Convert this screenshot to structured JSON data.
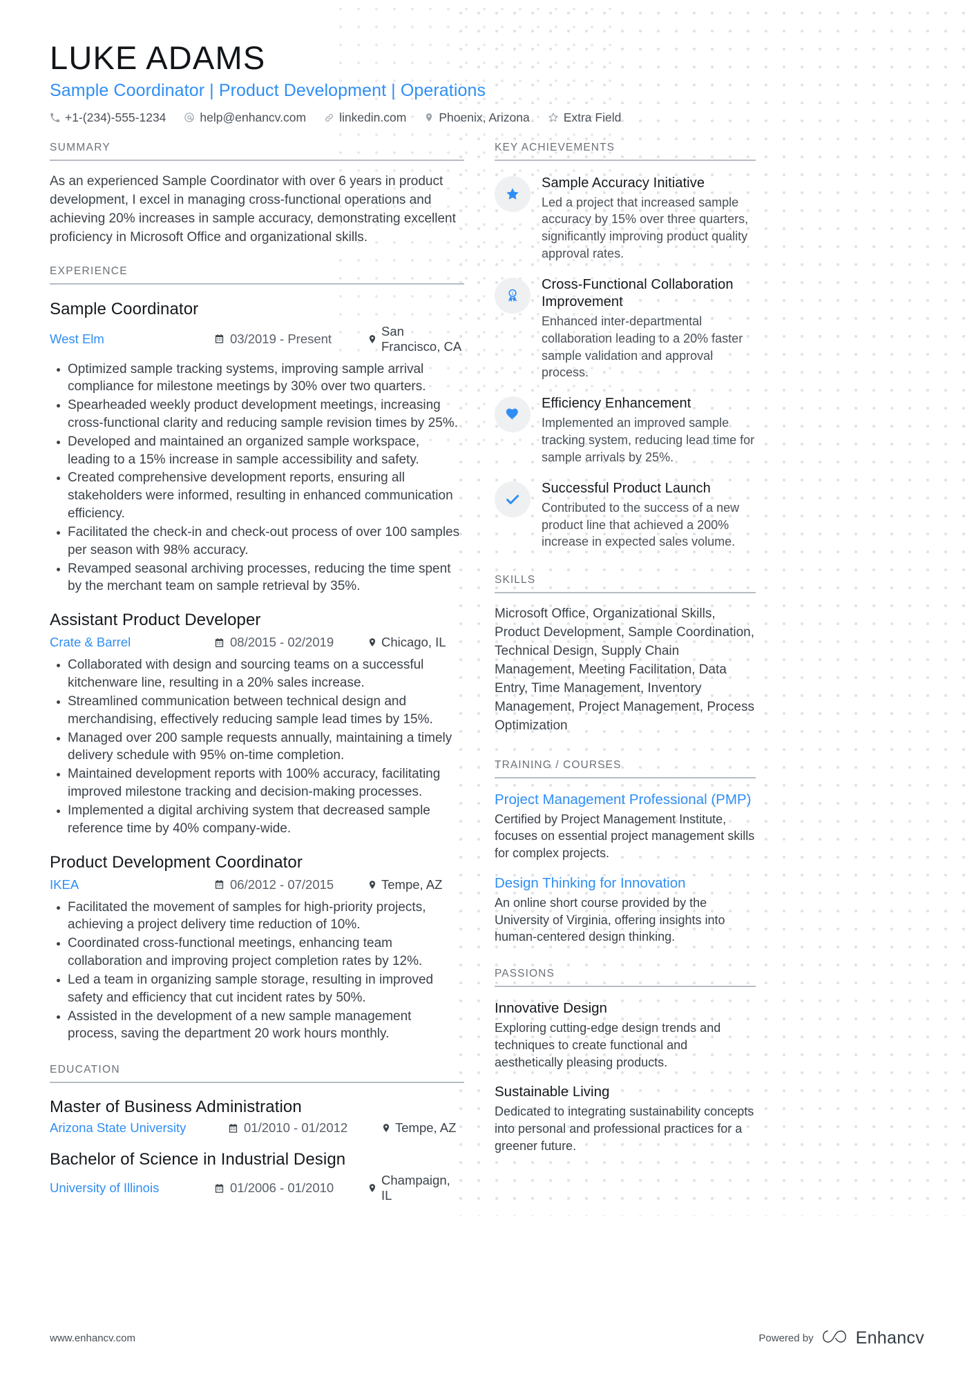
{
  "colors": {
    "accent": "#2f8ef4",
    "heading": "#6b7178",
    "text": "#3b4249",
    "badge_bg": "#eff0f1"
  },
  "header": {
    "name": "LUKE ADAMS",
    "headline": "Sample Coordinator | Product Development | Operations",
    "contacts": [
      {
        "icon": "phone-icon",
        "text": "+1-(234)-555-1234"
      },
      {
        "icon": "email-icon",
        "text": "help@enhancv.com"
      },
      {
        "icon": "link-icon",
        "text": "linkedin.com"
      },
      {
        "icon": "location-icon",
        "text": "Phoenix, Arizona"
      },
      {
        "icon": "star-outline-icon",
        "text": "Extra Field"
      }
    ]
  },
  "summary": {
    "title": "SUMMARY",
    "text": "As an experienced Sample Coordinator with over 6 years in product development, I excel in managing cross-functional operations and achieving 20% increases in sample accuracy, demonstrating excellent proficiency in Microsoft Office and organizational skills."
  },
  "experience": {
    "title": "EXPERIENCE",
    "entries": [
      {
        "role": "Sample Coordinator",
        "company": "West Elm",
        "dates": "03/2019 - Present",
        "location": "San Francisco, CA",
        "bullets": [
          "Optimized sample tracking systems, improving sample arrival compliance for milestone meetings by 30% over two quarters.",
          "Spearheaded weekly product development meetings, increasing cross-functional clarity and reducing sample revision times by 25%.",
          "Developed and maintained an organized sample workspace, leading to a 15% increase in sample accessibility and safety.",
          "Created comprehensive development reports, ensuring all stakeholders were informed, resulting in enhanced communication efficiency.",
          "Facilitated the check-in and check-out process of over 100 samples per season with 98% accuracy.",
          "Revamped seasonal archiving processes, reducing the time spent by the merchant team on sample retrieval by 35%."
        ]
      },
      {
        "role": "Assistant Product Developer",
        "company": "Crate & Barrel",
        "dates": "08/2015 - 02/2019",
        "location": "Chicago, IL",
        "bullets": [
          "Collaborated with design and sourcing teams on a successful kitchenware line, resulting in a 20% sales increase.",
          "Streamlined communication between technical design and merchandising, effectively reducing sample lead times by 15%.",
          "Managed over 200 sample requests annually, maintaining a timely delivery schedule with 95% on-time completion.",
          "Maintained development reports with 100% accuracy, facilitating improved milestone tracking and decision-making processes.",
          "Implemented a digital archiving system that decreased sample reference time by 40% company-wide."
        ]
      },
      {
        "role": "Product Development Coordinator",
        "company": "IKEA",
        "dates": "06/2012 - 07/2015",
        "location": "Tempe, AZ",
        "bullets": [
          "Facilitated the movement of samples for high-priority projects, achieving a project delivery time reduction of 10%.",
          "Coordinated cross-functional meetings, enhancing team collaboration and improving project completion rates by 12%.",
          "Led a team in organizing sample storage, resulting in improved safety and efficiency that cut incident rates by 50%.",
          "Assisted in the development of a new sample management process, saving the department 20 work hours monthly."
        ]
      }
    ]
  },
  "education": {
    "title": "EDUCATION",
    "entries": [
      {
        "degree": "Master of Business Administration",
        "school": "Arizona State University",
        "dates": "01/2010 - 01/2012",
        "location": "Tempe, AZ"
      },
      {
        "degree": "Bachelor of Science in Industrial Design",
        "school": "University of Illinois",
        "dates": "01/2006 - 01/2010",
        "location": "Champaign, IL"
      }
    ]
  },
  "key_achievements": {
    "title": "KEY ACHIEVEMENTS",
    "items": [
      {
        "icon": "star-icon",
        "title": "Sample Accuracy Initiative",
        "desc": "Led a project that increased sample accuracy by 15% over three quarters, significantly improving product quality approval rates."
      },
      {
        "icon": "award-ribbon-icon",
        "title": "Cross-Functional Collaboration Improvement",
        "desc": "Enhanced inter-departmental collaboration leading to a 20% faster sample validation and approval process."
      },
      {
        "icon": "heart-icon",
        "title": "Efficiency Enhancement",
        "desc": "Implemented an improved sample tracking system, reducing lead time for sample arrivals by 25%."
      },
      {
        "icon": "check-icon",
        "title": "Successful Product Launch",
        "desc": "Contributed to the success of a new product line that achieved a 200% increase in expected sales volume."
      }
    ]
  },
  "skills": {
    "title": "SKILLS",
    "text": "Microsoft Office, Organizational Skills, Product Development, Sample Coordination, Technical Design, Supply Chain Management, Meeting Facilitation, Data Entry, Time Management, Inventory Management, Project Management, Process Optimization"
  },
  "training": {
    "title": "TRAINING / COURSES",
    "items": [
      {
        "name": "Project Management Professional (PMP)",
        "desc": "Certified by Project Management Institute, focuses on essential project management skills for complex projects."
      },
      {
        "name": "Design Thinking for Innovation",
        "desc": "An online short course provided by the University of Virginia, offering insights into human-centered design thinking."
      }
    ]
  },
  "passions": {
    "title": "PASSIONS",
    "items": [
      {
        "name": "Innovative Design",
        "desc": "Exploring cutting-edge design trends and techniques to create functional and aesthetically pleasing products."
      },
      {
        "name": "Sustainable Living",
        "desc": "Dedicated to integrating sustainability concepts into personal and professional practices for a greener future."
      }
    ]
  },
  "footer": {
    "url": "www.enhancv.com",
    "powered_by": "Powered by",
    "brand": "Enhancv",
    "brand_icon": "enhancv-logo-icon"
  }
}
